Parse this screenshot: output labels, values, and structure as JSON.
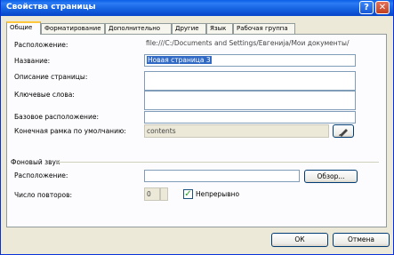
{
  "window": {
    "title": "Свойства страницы",
    "help_glyph": "?",
    "close_glyph": "✕"
  },
  "tabs": [
    "Общие",
    "Форматирование",
    "Дополнительно",
    "Другие",
    "Язык",
    "Рабочая группа"
  ],
  "fields": {
    "location": {
      "label": "Расположение:",
      "value": "file:///C:/Documents and Settings/Евгенија/Мои документы/"
    },
    "title": {
      "label": "Название:",
      "value": "Новая страница 3"
    },
    "description": {
      "label": "Описание страницы:",
      "value": ""
    },
    "keywords": {
      "label": "Ключевые слова:",
      "value": ""
    },
    "base": {
      "label": "Базовое расположение:",
      "value": ""
    },
    "default_target": {
      "label": "Конечная рамка по умолчанию:",
      "value": "contents"
    }
  },
  "background_sound": {
    "group_label": "Фоновый звук",
    "location_label": "Расположение:",
    "location_value": "",
    "browse_label": "Обзор...",
    "loop_label": "Число повторов:",
    "loop_value": "0",
    "forever_label": "Непрерывно",
    "forever_checked": true
  },
  "buttons": {
    "ok": "ОК",
    "cancel": "Отмена"
  }
}
